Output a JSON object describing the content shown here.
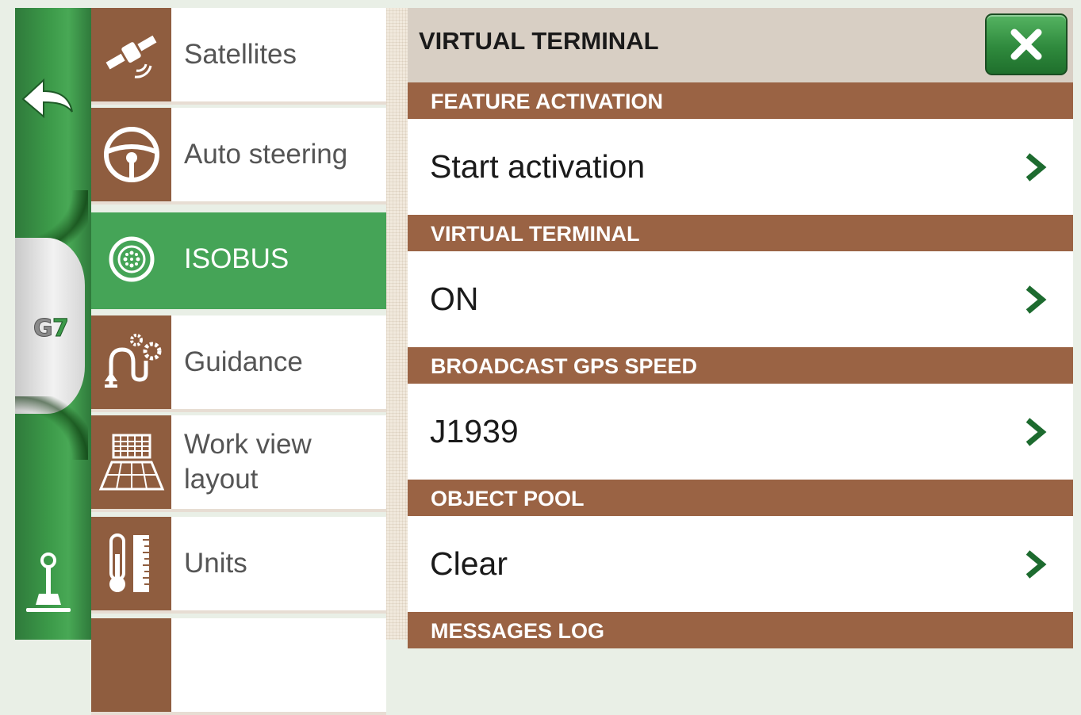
{
  "sidebar": {
    "back_icon": "back-arrow-icon",
    "logo_text": "G7",
    "bottom_icon": "joystick-icon",
    "colors": {
      "rail": "#3c9a49",
      "active": "#45a457",
      "icon_bg": "#8f5d3f"
    }
  },
  "menu": {
    "items": [
      {
        "label": "Satellites",
        "icon": "satellite-icon"
      },
      {
        "label": "Auto steering",
        "icon": "steering-wheel-icon"
      },
      {
        "label": "ISOBUS",
        "icon": "isobus-connector-icon",
        "active": true
      },
      {
        "label": "Guidance",
        "icon": "guidance-gears-icon"
      },
      {
        "label": "Work view layout",
        "icon": "work-view-layout-icon"
      },
      {
        "label": "Units",
        "icon": "units-thermometer-ruler-icon"
      }
    ]
  },
  "panel": {
    "title": "VIRTUAL TERMINAL",
    "close_icon": "close-icon",
    "sections": [
      {
        "header": "FEATURE ACTIVATION",
        "value": "Start activation"
      },
      {
        "header": "VIRTUAL TERMINAL",
        "value": "ON"
      },
      {
        "header": "BROADCAST GPS SPEED",
        "value": "J1939"
      },
      {
        "header": "OBJECT POOL",
        "value": "Clear"
      },
      {
        "header": "MESSAGES LOG"
      }
    ],
    "colors": {
      "section_header": "#9a6344",
      "header_bg": "#d8cfc4",
      "chevron": "#1d6b2f"
    }
  }
}
